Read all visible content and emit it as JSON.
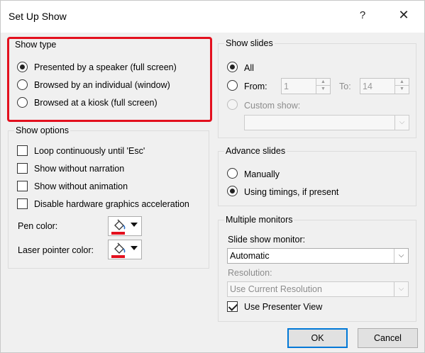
{
  "window": {
    "title": "Set Up Show",
    "help_glyph": "?",
    "close_glyph": "✕"
  },
  "show_type": {
    "title": "Show type",
    "options": [
      {
        "label": "Presented by a speaker (full screen)",
        "checked": true
      },
      {
        "label": "Browsed by an individual (window)",
        "checked": false
      },
      {
        "label": "Browsed at a kiosk (full screen)",
        "checked": false
      }
    ]
  },
  "show_options": {
    "title": "Show options",
    "checkboxes": [
      {
        "label": "Loop continuously until 'Esc'",
        "checked": false
      },
      {
        "label": "Show without narration",
        "checked": false
      },
      {
        "label": "Show without animation",
        "checked": false
      },
      {
        "label": "Disable hardware graphics acceleration",
        "checked": false
      }
    ],
    "pen_color_label": "Pen color:",
    "laser_color_label": "Laser pointer color:",
    "pen_color": "#e3101e",
    "laser_color": "#e3101e"
  },
  "show_slides": {
    "title": "Show slides",
    "all_label": "All",
    "from_label": "From:",
    "from_value": "1",
    "to_label": "To:",
    "to_value": "14",
    "custom_label": "Custom show:",
    "custom_value": ""
  },
  "advance_slides": {
    "title": "Advance slides",
    "options": [
      {
        "label": "Manually",
        "checked": false
      },
      {
        "label": "Using timings, if present",
        "checked": true
      }
    ]
  },
  "monitors": {
    "title": "Multiple monitors",
    "monitor_label": "Slide show monitor:",
    "monitor_value": "Automatic",
    "resolution_label": "Resolution:",
    "resolution_value": "Use Current Resolution",
    "presenter_view_label": "Use Presenter View",
    "presenter_view_checked": true
  },
  "buttons": {
    "ok": "OK",
    "cancel": "Cancel"
  },
  "colors": {
    "highlight": "#e3101e",
    "default_button_border": "#0078d7"
  }
}
